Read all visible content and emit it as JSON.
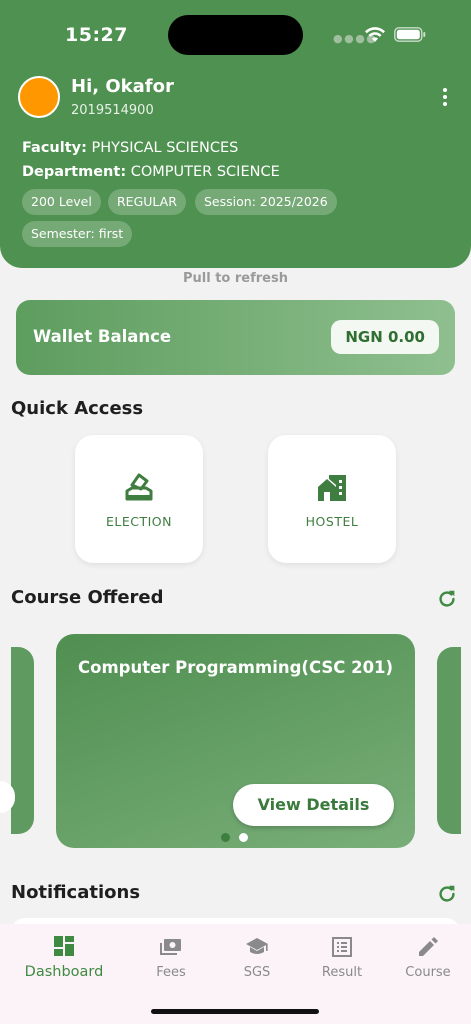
{
  "status_bar": {
    "time": "15:27"
  },
  "user": {
    "greeting": "Hi, Okafor",
    "matric_number": "2019514900",
    "faculty_label": "Faculty:",
    "faculty_value": "PHYSICAL SCIENCES",
    "department_label": "Department:",
    "department_value": "COMPUTER SCIENCE",
    "chips": {
      "level": "200 Level",
      "mode": "REGULAR",
      "session": "Session: 2025/2026",
      "semester": "Semester: first"
    }
  },
  "pull_to_refresh": "Pull to refresh",
  "wallet": {
    "label": "Wallet Balance",
    "amount": "NGN 0.00"
  },
  "quick_access": {
    "title": "Quick Access",
    "items": [
      {
        "label": "ELECTION",
        "icon": "ballot-box-icon"
      },
      {
        "label": "HOSTEL",
        "icon": "building-icon"
      }
    ]
  },
  "courses": {
    "title": "Course Offered",
    "current": {
      "name": "Computer Programming(CSC 201)",
      "button": "View Details"
    },
    "page_count": 2,
    "active_page": 2
  },
  "notifications": {
    "title": "Notifications"
  },
  "bottom_nav": {
    "items": [
      {
        "label": "Dashboard",
        "icon": "dashboard-icon",
        "active": true
      },
      {
        "label": "Fees",
        "icon": "payments-icon",
        "active": false
      },
      {
        "label": "SGS",
        "icon": "graduation-cap-icon",
        "active": false
      },
      {
        "label": "Result",
        "icon": "list-alt-icon",
        "active": false
      },
      {
        "label": "Course",
        "icon": "pencil-icon",
        "active": false
      }
    ]
  },
  "colors": {
    "primary_green": "#4f9150",
    "avatar": "#ff9800",
    "nav_background": "#fbf3f8"
  }
}
